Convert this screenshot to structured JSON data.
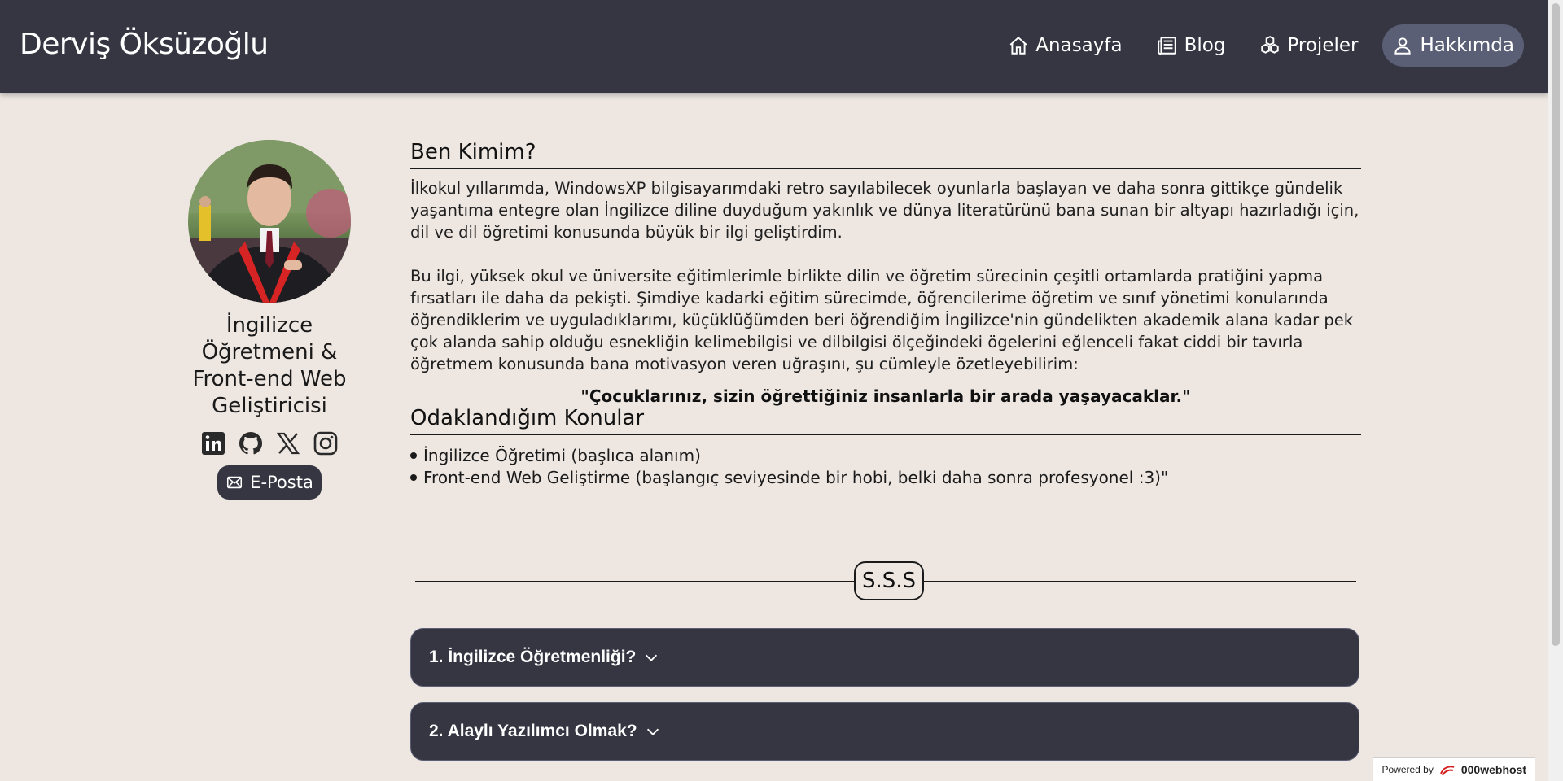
{
  "header": {
    "brand": "Derviş Öksüzoğlu",
    "nav": [
      {
        "label": "Anasayfa",
        "icon": "home-icon"
      },
      {
        "label": "Blog",
        "icon": "newspaper-icon"
      },
      {
        "label": "Projeler",
        "icon": "boxes-icon"
      },
      {
        "label": "Hakkımda",
        "icon": "user-icon",
        "active": true
      }
    ]
  },
  "profile": {
    "role": "İngilizce Öğretmeni & Front-end Web Geliştiricisi",
    "social": [
      "linkedin-icon",
      "github-icon",
      "x-icon",
      "instagram-icon"
    ],
    "email_label": "E-Posta"
  },
  "about": {
    "title": "Ben Kimim?",
    "paragraph1": "İlkokul yıllarımda, WindowsXP bilgisayarımdaki retro sayılabilecek oyunlarla başlayan ve daha sonra gittikçe gündelik yaşantıma entegre olan İngilizce diline duyduğum yakınlık ve dünya literatürünü bana sunan bir altyapı hazırladığı için, dil ve dil öğretimi konusunda büyük bir ilgi geliştirdim.",
    "paragraph2": "Bu ilgi, yüksek okul ve üniversite eğitimlerimle birlikte dilin ve öğretim sürecinin çeşitli ortamlarda pratiğini yapma fırsatları ile daha da pekişti. Şimdiye kadarki eğitim sürecimde, öğrencilerime öğretim ve sınıf yönetimi konularında öğrendiklerim ve uyguladıklarımı, küçüklüğümden beri öğrendiğim İngilizce'nin gündelikten akademik alana kadar pek çok alanda sahip olduğu esnekliğin kelimebilgisi ve dilbilgisi ölçeğindeki ögelerini eğlenceli fakat ciddi bir tavırla öğretmem konusunda bana motivasyon veren uğraşını, şu cümleyle özetleyebilirim:",
    "quote": "\"Çocuklarınız, sizin öğrettiğiniz insanlarla bir arada yaşayacaklar.\""
  },
  "focus": {
    "title": "Odaklandığım Konular",
    "items": [
      "İngilizce Öğretimi (başlıca alanım)",
      "Front-end Web Geliştirme (başlangıç seviyesinde bir hobi, belki daha sonra profesyonel :3)\""
    ]
  },
  "faq": {
    "badge": "S.S.S",
    "items": [
      "1. İngilizce Öğretmenliği?",
      "2. Alaylı Yazılımcı Olmak?"
    ]
  },
  "footer": {
    "powered_by": "Powered by",
    "host": "000webhost"
  },
  "colors": {
    "header_bg": "#353642",
    "page_bg": "#ede6e1",
    "active_nav": "#5b5f75"
  }
}
